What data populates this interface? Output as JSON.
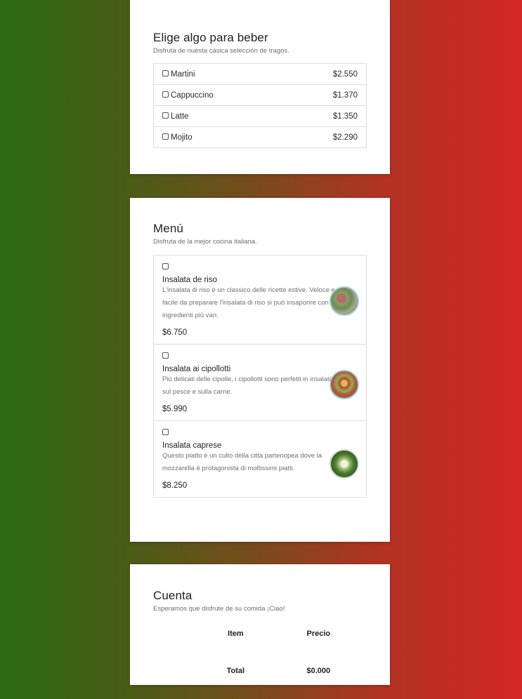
{
  "drinks": {
    "title": "Elige algo para beber",
    "subtitle": "Disfruta de nuesta cásica selección de tragos.",
    "items": [
      {
        "name": "Martini",
        "price": "$2.550"
      },
      {
        "name": "Cappuccino",
        "price": "$1.370"
      },
      {
        "name": "Latte",
        "price": "$1.350"
      },
      {
        "name": "Mojito",
        "price": "$2.290"
      }
    ]
  },
  "menu": {
    "title": "Menú",
    "subtitle": "Disfruta de la mejor cocina italiana.",
    "items": [
      {
        "name": "Insalata de riso",
        "description": "L'insalata di riso è un classico delle ricette estive. Veloce e facile da preparare l'insalata di riso si può insaporire con gli ingredienti più vari.",
        "price": "$6.750"
      },
      {
        "name": "Insalata ai cipollotti",
        "description": "Più delicati delle cipolle, i cipollotti sono perfetti in insalata, sul pesce e sulla carne.",
        "price": "$5.990"
      },
      {
        "name": "Insalata caprese",
        "description": "Questo piatto è un culto della città partenopea dove la mozzarella è protagonista di moltissimi piatti.",
        "price": "$8.250"
      }
    ]
  },
  "bill": {
    "title": "Cuenta",
    "subtitle": "Esperamos que disfrute de su comida ¡Ciao!",
    "header_item": "Item",
    "header_price": "Precio",
    "total_label": "Total",
    "total_value": "$0.000"
  },
  "colors": {
    "gradient_left": "#2a6a0f",
    "gradient_right": "#d32725",
    "card_background": "#ffffff"
  }
}
